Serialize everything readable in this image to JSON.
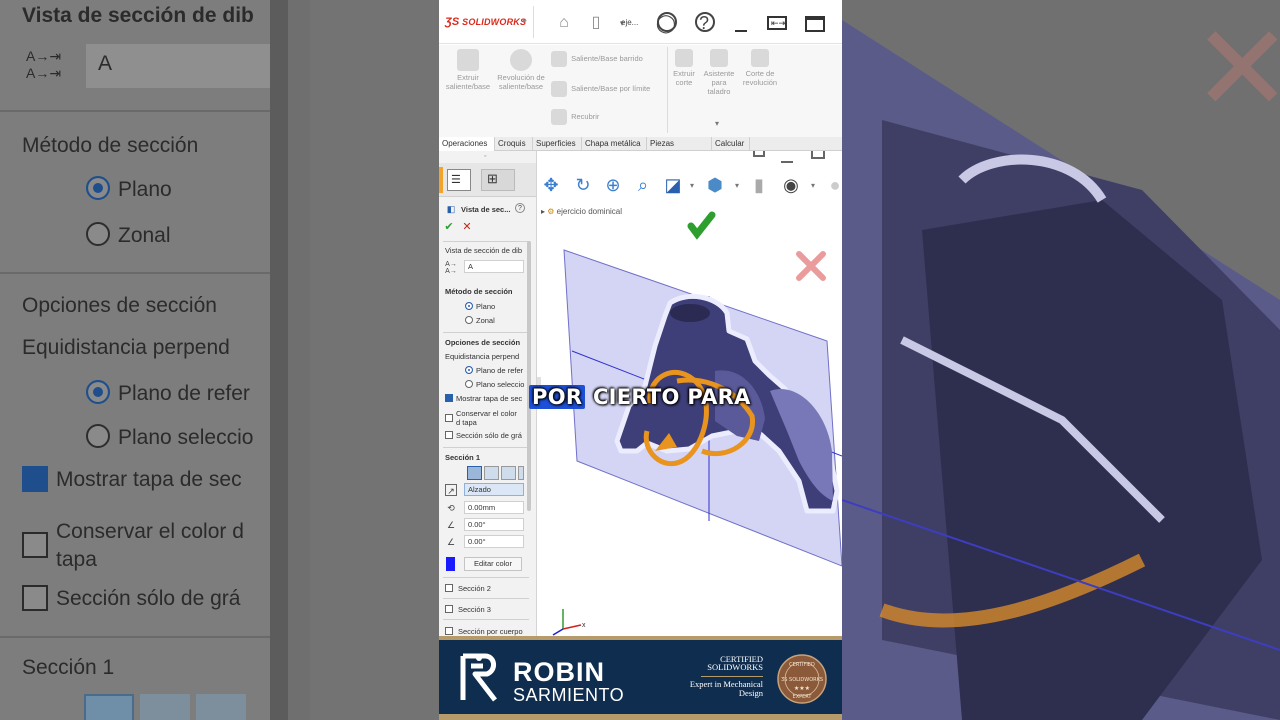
{
  "app": {
    "brand": "SOLIDWORKS",
    "document": "eje..."
  },
  "ribbon": {
    "items": [
      {
        "label": "Extruir saliente/base"
      },
      {
        "label": "Revolución de saliente/base"
      },
      {
        "label": "Saliente/Base barrido"
      },
      {
        "label": "Saliente/Base por límite"
      },
      {
        "label": "Recubrir"
      },
      {
        "label": "Extruir corte"
      },
      {
        "label": "Asistente para taladro"
      },
      {
        "label": "Corte de revolución"
      }
    ]
  },
  "tabs": [
    "Operaciones",
    "Croquis",
    "Superficies",
    "Chapa metálica",
    "Piezas soldadas",
    "Calcular"
  ],
  "property_manager": {
    "title": "Vista de sec...",
    "group_label": "Vista de sección de dib",
    "section_name": "A",
    "method_heading": "Método de sección",
    "method_plane": "Plano",
    "method_zonal": "Zonal",
    "options_heading": "Opciones de sección",
    "equidistance": "Equidistancia perpend",
    "ref_plane": "Plano de refer",
    "selected_plane": "Plano seleccio",
    "show_cap": "Mostrar tapa de sec",
    "keep_color": "Conservar el color d tapa",
    "graphics_only": "Sección sólo de grá",
    "section1": "Sección 1",
    "plane_value": "Alzado",
    "distance": "0.00mm",
    "angle_x": "0.00°",
    "angle_y": "0.00°",
    "edit_color": "Editar color",
    "section2": "Sección 2",
    "section3": "Sección 3",
    "by_body": "Sección por cuerpo"
  },
  "viewport": {
    "tree_item": "ejercicio dominical",
    "triad_x": "x"
  },
  "caption": {
    "highlight": "POR",
    "rest": " CIERTO PARA"
  },
  "banner": {
    "name_first": "ROBIN",
    "name_last": "SARMIENTO",
    "cert_title": "CERTIFIED SOLIDWORKS",
    "cert_sub": "Expert in Mechanical Design"
  },
  "background": {
    "labels": [
      "Vista de sección de dib",
      "A",
      "Método de sección",
      "Plano",
      "Zonal",
      "Opciones de sección",
      "Equidistancia perpend",
      "Plano de refer",
      "Plano seleccio",
      "Mostrar tapa de sec",
      "Conservar el color d",
      "tapa",
      "Sección sólo de grá",
      "Sección 1"
    ]
  },
  "colors": {
    "accent": "#2a5fad",
    "banner": "#0f2d4f",
    "gold": "#b79a6a",
    "confirm": "#2e9e2e",
    "cancel": "#e37a7a",
    "section_plane": "#8e8ee0",
    "caption_highlight": "#1d4fd8"
  }
}
